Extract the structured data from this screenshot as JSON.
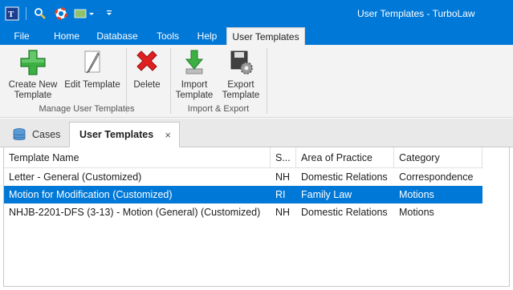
{
  "window": {
    "title": "User Templates - TurboLaw"
  },
  "ribbon_tabs": [
    {
      "label": "File"
    },
    {
      "label": "Home"
    },
    {
      "label": "Database"
    },
    {
      "label": "Tools"
    },
    {
      "label": "Help"
    },
    {
      "label": "User Templates"
    }
  ],
  "ribbon": {
    "create": {
      "line1": "Create New",
      "line2": "Template",
      "icon": "plus-icon"
    },
    "edit": {
      "label": "Edit Template",
      "icon": "pencil-icon"
    },
    "delete": {
      "label": "Delete",
      "icon": "red-x-icon"
    },
    "import": {
      "line1": "Import",
      "line2": "Template",
      "icon": "download-arrow-icon"
    },
    "export": {
      "line1": "Export",
      "line2": "Template",
      "icon": "save-gear-icon"
    },
    "group_manage": "Manage User Templates",
    "group_io": "Import & Export"
  },
  "doc_tabs": {
    "cases": "Cases",
    "user_templates": "User Templates",
    "close_glyph": "×"
  },
  "grid": {
    "columns": [
      "Template Name",
      "S...",
      "Area of Practice",
      "Category"
    ],
    "rows": [
      {
        "name": "Letter - General (Customized)",
        "state": "NH",
        "area": "Domestic Relations",
        "category": "Correspondence",
        "selected": false
      },
      {
        "name": "Motion for Modification (Customized)",
        "state": "RI",
        "area": "Family Law",
        "category": "Motions",
        "selected": true
      },
      {
        "name": "NHJB-2201-DFS (3-13) - Motion (General) (Customized)",
        "state": "NH",
        "area": "Domestic Relations",
        "category": "Motions",
        "selected": false
      }
    ]
  },
  "colors": {
    "accent": "#0078d7",
    "selection": "#0078d7"
  }
}
